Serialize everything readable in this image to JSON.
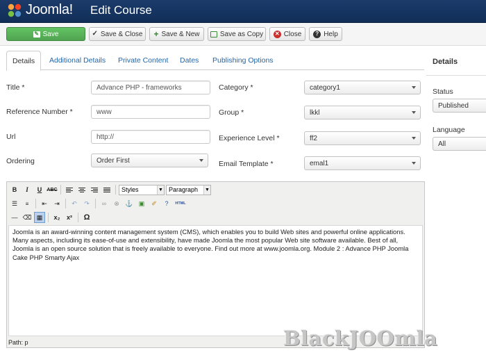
{
  "header": {
    "logo_text": "Joomla!",
    "title": "Edit Course"
  },
  "toolbar": {
    "save": "Save",
    "save_close": "Save & Close",
    "save_new": "Save & New",
    "save_copy": "Save as Copy",
    "close": "Close",
    "help": "Help"
  },
  "tabs": [
    "Details",
    "Additional Details",
    "Private Content",
    "Dates",
    "Publishing Options"
  ],
  "form": {
    "title": {
      "label": "Title *",
      "value": "Advance PHP - frameworks"
    },
    "reference": {
      "label": "Reference Number *",
      "value": "www"
    },
    "url": {
      "label": "Url",
      "value": "http://"
    },
    "ordering": {
      "label": "Ordering",
      "value": "Order First"
    },
    "category": {
      "label": "Category *",
      "value": "category1"
    },
    "group": {
      "label": "Group *",
      "value": "lkkl"
    },
    "experience": {
      "label": "Experience Level *",
      "value": "ff2"
    },
    "email_template": {
      "label": "Email Template *",
      "value": "emal1"
    }
  },
  "sidebar": {
    "title": "Details",
    "status": {
      "label": "Status",
      "value": "Published"
    },
    "language": {
      "label": "Language",
      "value": "All"
    }
  },
  "editor": {
    "styles": "Styles",
    "format": "Paragraph",
    "html_label": "HTML",
    "content": "Joomla is an award-winning content management system (CMS), which enables you to build Web sites and powerful online applications. Many aspects, including its ease-of-use and extensibility, have made Joomla the most popular Web site software available. Best of all, Joomla is an open source solution that is freely available to everyone. Find out more at www.joomla.org. Module 2 : Advance PHP Joomla Cake PHP Smarty Ajax",
    "path": "Path: p"
  },
  "watermark": "BlackJOOmla",
  "colors": {
    "header": "#1c3b6a",
    "save": "#51a351",
    "link": "#2266aa",
    "close": "#c9302c"
  }
}
